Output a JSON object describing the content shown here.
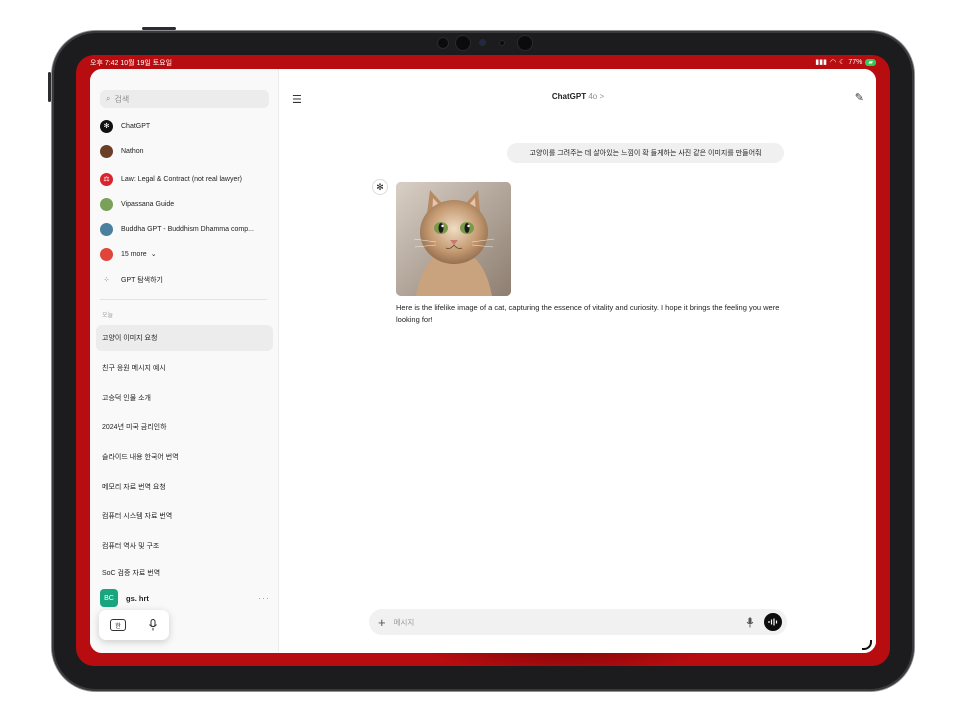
{
  "statusbar": {
    "time": "오후 7:42  10월 19일 토요일",
    "battery": "77%"
  },
  "sidebar": {
    "search_placeholder": "검색",
    "gpts": [
      {
        "label": "ChatGPT"
      },
      {
        "label": "Nathon"
      },
      {
        "label": "Law: Legal & Contract (not real lawyer)"
      },
      {
        "label": "Vipassana Guide"
      },
      {
        "label": "Buddha GPT - Buddhism Dhamma comp..."
      },
      {
        "label": "15 more"
      },
      {
        "label": "GPT 탐색하기"
      }
    ],
    "section_today": "오늘",
    "chats": [
      {
        "label": "고양이 이미지 요청"
      },
      {
        "label": "친구 응원 메시지 예시"
      },
      {
        "label": "고승덕 인물 소개"
      },
      {
        "label": "2024년 미국 금리인하"
      },
      {
        "label": "슬라이드 내용 한국어 번역"
      },
      {
        "label": "메모리 자료 번역 요청"
      },
      {
        "label": "컴퓨터 시스템 자료 번역"
      },
      {
        "label": "컴퓨터 역사 및 구조"
      },
      {
        "label": "SoC 검증 자료 번역"
      }
    ],
    "user": {
      "initials": "BC",
      "name": "gs. hrt",
      "more": "···"
    },
    "keyboard_lang": "한"
  },
  "header": {
    "title": "ChatGPT",
    "model": "4o >"
  },
  "conversation": {
    "user_message": "고양이를 그려주는 데 살아있는 느낌이 확 들게하는 사진 같은 이미지를 만들어줘",
    "assistant_message": "Here is the lifelike image of a cat, capturing the essence of vitality and curiosity. I hope it brings the feeling you were looking for!"
  },
  "composer": {
    "placeholder": "메시지"
  },
  "colors": {
    "accent": "#19a67f",
    "wallpaper": "#b80d10",
    "frame": "#1c1c1e"
  }
}
